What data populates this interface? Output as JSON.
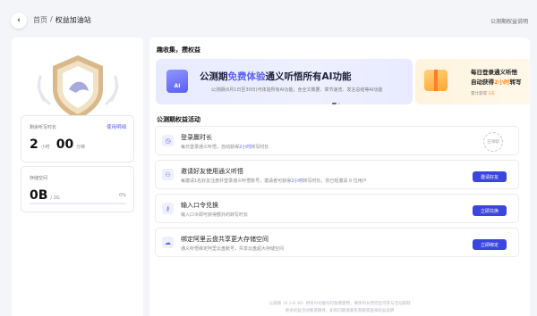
{
  "breadcrumb": {
    "home": "首页",
    "separator": "/",
    "current": "权益加油站"
  },
  "top_link": "公测期权益说明",
  "left": {
    "duration_card": {
      "label": "剩余听写时长",
      "link": "使用明细",
      "hours": "2",
      "hours_unit": "小时",
      "minutes": "00",
      "minutes_unit": "分钟"
    },
    "storage_card": {
      "label": "存储空间",
      "used": "0B",
      "total": "/ 2G",
      "percent": "0%",
      "used_fraction": 0
    }
  },
  "sections": {
    "collect": "趣收集，攒权益",
    "activity": "公测期权益活动"
  },
  "banner": {
    "icon": "AI",
    "title_prefix": "公测期",
    "title_hl": "免费体验",
    "title_suffix": "通义听悟所有AI功能",
    "subtitle": "公测期(6月1日至30日)可体验所有AI功能，含全文概要、章节速览、发言总结等AI功能"
  },
  "banner2": {
    "title1": "每日登录通义听悟",
    "title2_prefix": "自动获得",
    "title2_hl": "2小时",
    "title2_suffix": "转写",
    "sub_prefix": "累计获得",
    "sub_hl": "2天"
  },
  "tasks": [
    {
      "icon": "clock-icon",
      "glyph": "◷",
      "title": "登录赢时长",
      "desc_prefix": "每日登录通义听悟，自动获得",
      "desc_hl": "2小时",
      "desc_suffix": "转写时长",
      "action": "已领取",
      "done": true
    },
    {
      "icon": "user-add-icon",
      "glyph": "⚇",
      "title": "邀请好友使用通义听悟",
      "desc_prefix": "每邀请1名好友注册并登录通义听悟账号，邀请者可获得",
      "desc_hl": "2小时",
      "desc_suffix": "转写时长，你已经邀请 0 位用户",
      "action": "邀请好友",
      "done": false
    },
    {
      "icon": "key-icon",
      "glyph": "⚷",
      "title": "输入口令兑换",
      "desc_prefix": "输入口令即可获得额外的转写时长",
      "desc_hl": "",
      "desc_suffix": "",
      "action": "立即兑换",
      "done": false
    },
    {
      "icon": "cloud-drive-icon",
      "glyph": "☁",
      "title": "绑定阿里云盘共享更大存储空间",
      "desc_prefix": "通义听悟绑定阿里云盘账号，共享云盘超大存储空间",
      "desc_hl": "",
      "desc_suffix": "",
      "action": "立即绑定",
      "done": false
    }
  ],
  "footer": {
    "line1": "公测期（6.1-6.30）所有AI功能均可免费使用，剩余时长用完后可参与活动获取",
    "line2": "更多权益活动敬请期待，如有问题请联系客服或查阅权益说明"
  }
}
